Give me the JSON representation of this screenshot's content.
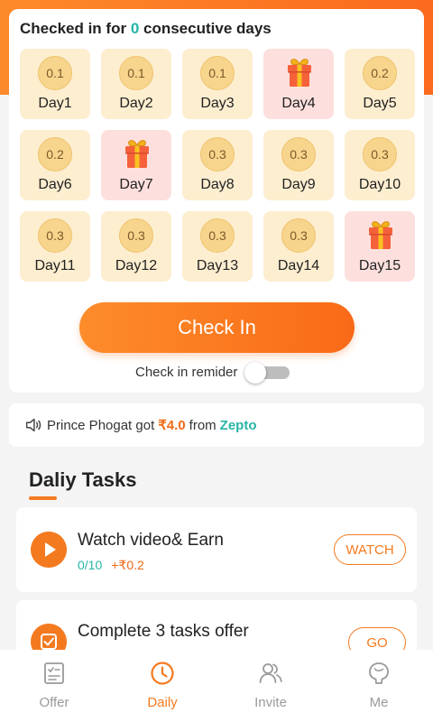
{
  "checkin": {
    "title_prefix": "Checked in for ",
    "days_count": "0",
    "title_suffix": " consecutive days",
    "days": [
      {
        "label": "Day1",
        "reward": "0.1",
        "gift": false
      },
      {
        "label": "Day2",
        "reward": "0.1",
        "gift": false
      },
      {
        "label": "Day3",
        "reward": "0.1",
        "gift": false
      },
      {
        "label": "Day4",
        "reward": "",
        "gift": true
      },
      {
        "label": "Day5",
        "reward": "0.2",
        "gift": false
      },
      {
        "label": "Day6",
        "reward": "0.2",
        "gift": false
      },
      {
        "label": "Day7",
        "reward": "",
        "gift": true
      },
      {
        "label": "Day8",
        "reward": "0.3",
        "gift": false
      },
      {
        "label": "Day9",
        "reward": "0.3",
        "gift": false
      },
      {
        "label": "Day10",
        "reward": "0.3",
        "gift": false
      },
      {
        "label": "Day11",
        "reward": "0.3",
        "gift": false
      },
      {
        "label": "Day12",
        "reward": "0.3",
        "gift": false
      },
      {
        "label": "Day13",
        "reward": "0.3",
        "gift": false
      },
      {
        "label": "Day14",
        "reward": "0.3",
        "gift": false
      },
      {
        "label": "Day15",
        "reward": "",
        "gift": true
      }
    ],
    "button_label": "Check In",
    "reminder_label": "Check in remider",
    "reminder_on": false
  },
  "ticker": {
    "user_text": "Prince Phogat got",
    "amount": "₹4.0",
    "from_text": "from",
    "brand": "Zepto",
    "icon": "speaker-icon"
  },
  "tasks": {
    "title": "Daliy Tasks",
    "items": [
      {
        "name": "Watch video& Earn",
        "progress": "0/10",
        "reward": "+₹0.2",
        "button": "WATCH",
        "icon": "play-icon"
      },
      {
        "name": "Complete  3 tasks offer",
        "progress": "",
        "reward": "",
        "button": "GO",
        "icon": "check-icon"
      }
    ]
  },
  "tabbar": {
    "items": [
      {
        "label": "Offer",
        "icon": "offer-icon",
        "active": false
      },
      {
        "label": "Daily",
        "icon": "clock-icon",
        "active": true
      },
      {
        "label": "Invite",
        "icon": "invite-icon",
        "active": false
      },
      {
        "label": "Me",
        "icon": "me-icon",
        "active": false
      }
    ]
  },
  "colors": {
    "accent": "#f47a20",
    "teal": "#27b5a6",
    "coin": "#f7d58d",
    "day_bg": "#fdeed0",
    "gift_bg": "#fde0dd"
  }
}
